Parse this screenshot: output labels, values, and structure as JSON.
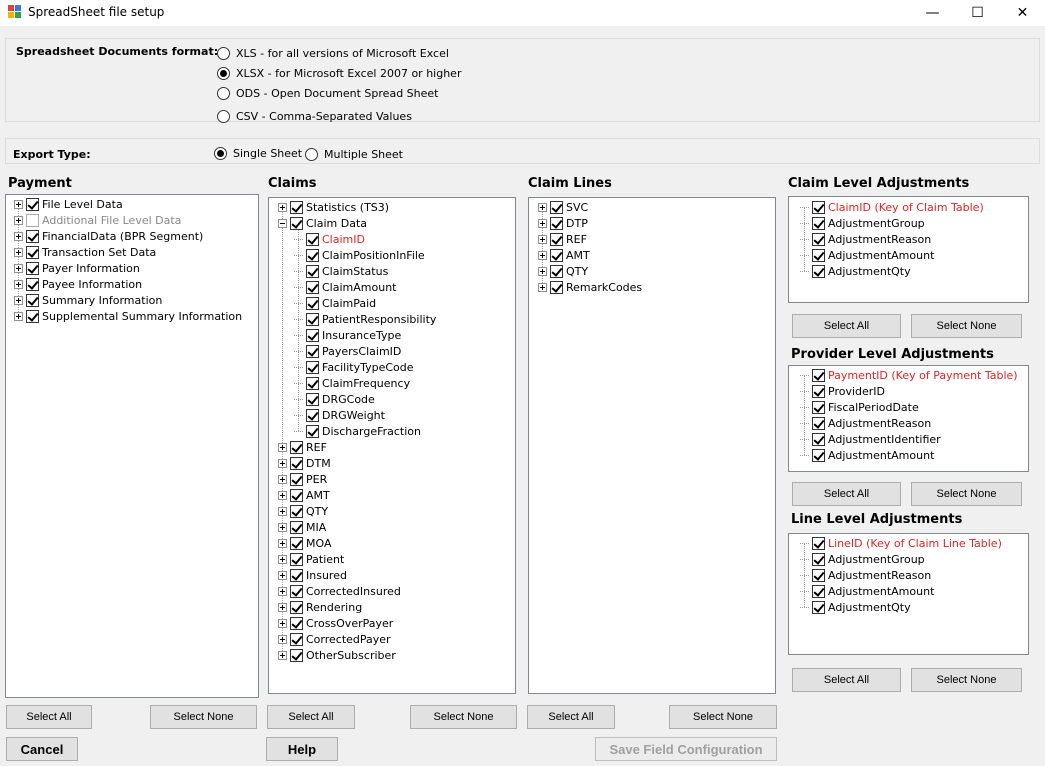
{
  "window": {
    "title": "SpreadSheet file setup",
    "minimize_glyph": "—",
    "maximize_glyph": "☐",
    "close_glyph": "✕"
  },
  "format": {
    "label": "Spreadsheet Documents format:",
    "options": [
      {
        "label": "XLS - for all versions of Microsoft Excel",
        "checked": false
      },
      {
        "label": "XLSX - for Microsoft Excel 2007 or higher",
        "checked": true
      },
      {
        "label": "ODS - Open Document Spread Sheet",
        "checked": false
      },
      {
        "label": "CSV - Comma-Separated Values",
        "checked": false
      }
    ]
  },
  "export_type": {
    "label": "Export Type:",
    "options": [
      {
        "label": "Single Sheet",
        "checked": true
      },
      {
        "label": "Multiple Sheet",
        "checked": false
      }
    ]
  },
  "payment": {
    "title": "Payment",
    "items": [
      {
        "label": "File Level Data",
        "expander": "plus",
        "checked": true,
        "style": ""
      },
      {
        "label": "Additional File Level Data",
        "expander": "plus",
        "checked": false,
        "style": "gray"
      },
      {
        "label": "FinancialData (BPR Segment)",
        "expander": "plus",
        "checked": true,
        "style": ""
      },
      {
        "label": "Transaction Set Data",
        "expander": "plus",
        "checked": true,
        "style": ""
      },
      {
        "label": "Payer Information",
        "expander": "plus",
        "checked": true,
        "style": ""
      },
      {
        "label": "Payee Information",
        "expander": "plus",
        "checked": true,
        "style": ""
      },
      {
        "label": "Summary Information",
        "expander": "plus",
        "checked": true,
        "style": ""
      },
      {
        "label": "Supplemental Summary Information",
        "expander": "plus",
        "checked": true,
        "style": ""
      }
    ],
    "select_all": "Select All",
    "select_none": "Select None"
  },
  "claims": {
    "title": "Claims",
    "items": [
      {
        "label": "Statistics (TS3)",
        "expander": "plus",
        "checked": true,
        "level": 0,
        "style": ""
      },
      {
        "label": "Claim Data",
        "expander": "minus",
        "checked": true,
        "level": 0,
        "style": ""
      },
      {
        "label": "ClaimID",
        "expander": "",
        "checked": true,
        "level": 1,
        "style": "red"
      },
      {
        "label": "ClaimPositionInFile",
        "expander": "",
        "checked": true,
        "level": 1,
        "style": ""
      },
      {
        "label": "ClaimStatus",
        "expander": "",
        "checked": true,
        "level": 1,
        "style": ""
      },
      {
        "label": "ClaimAmount",
        "expander": "",
        "checked": true,
        "level": 1,
        "style": ""
      },
      {
        "label": "ClaimPaid",
        "expander": "",
        "checked": true,
        "level": 1,
        "style": ""
      },
      {
        "label": "PatientResponsibility",
        "expander": "",
        "checked": true,
        "level": 1,
        "style": ""
      },
      {
        "label": "InsuranceType",
        "expander": "",
        "checked": true,
        "level": 1,
        "style": ""
      },
      {
        "label": "PayersClaimID",
        "expander": "",
        "checked": true,
        "level": 1,
        "style": ""
      },
      {
        "label": "FacilityTypeCode",
        "expander": "",
        "checked": true,
        "level": 1,
        "style": ""
      },
      {
        "label": "ClaimFrequency",
        "expander": "",
        "checked": true,
        "level": 1,
        "style": ""
      },
      {
        "label": "DRGCode",
        "expander": "",
        "checked": true,
        "level": 1,
        "style": ""
      },
      {
        "label": "DRGWeight",
        "expander": "",
        "checked": true,
        "level": 1,
        "style": ""
      },
      {
        "label": "DischargeFraction",
        "expander": "",
        "checked": true,
        "level": 1,
        "style": ""
      },
      {
        "label": "REF",
        "expander": "plus",
        "checked": true,
        "level": 0,
        "style": ""
      },
      {
        "label": "DTM",
        "expander": "plus",
        "checked": true,
        "level": 0,
        "style": ""
      },
      {
        "label": "PER",
        "expander": "plus",
        "checked": true,
        "level": 0,
        "style": ""
      },
      {
        "label": "AMT",
        "expander": "plus",
        "checked": true,
        "level": 0,
        "style": ""
      },
      {
        "label": "QTY",
        "expander": "plus",
        "checked": true,
        "level": 0,
        "style": ""
      },
      {
        "label": "MIA",
        "expander": "plus",
        "checked": true,
        "level": 0,
        "style": ""
      },
      {
        "label": "MOA",
        "expander": "plus",
        "checked": true,
        "level": 0,
        "style": ""
      },
      {
        "label": "Patient",
        "expander": "plus",
        "checked": true,
        "level": 0,
        "style": ""
      },
      {
        "label": "Insured",
        "expander": "plus",
        "checked": true,
        "level": 0,
        "style": ""
      },
      {
        "label": "CorrectedInsured",
        "expander": "plus",
        "checked": true,
        "level": 0,
        "style": ""
      },
      {
        "label": "Rendering",
        "expander": "plus",
        "checked": true,
        "level": 0,
        "style": ""
      },
      {
        "label": "CrossOverPayer",
        "expander": "plus",
        "checked": true,
        "level": 0,
        "style": ""
      },
      {
        "label": "CorrectedPayer",
        "expander": "plus",
        "checked": true,
        "level": 0,
        "style": ""
      },
      {
        "label": "OtherSubscriber",
        "expander": "plus",
        "checked": true,
        "level": 0,
        "style": ""
      }
    ],
    "select_all": "Select All",
    "select_none": "Select None"
  },
  "claim_lines": {
    "title": "Claim Lines",
    "items": [
      {
        "label": "SVC",
        "expander": "plus",
        "checked": true,
        "style": ""
      },
      {
        "label": "DTP",
        "expander": "plus",
        "checked": true,
        "style": ""
      },
      {
        "label": "REF",
        "expander": "plus",
        "checked": true,
        "style": ""
      },
      {
        "label": "AMT",
        "expander": "plus",
        "checked": true,
        "style": ""
      },
      {
        "label": "QTY",
        "expander": "plus",
        "checked": true,
        "style": ""
      },
      {
        "label": "RemarkCodes",
        "expander": "plus",
        "checked": true,
        "style": ""
      }
    ],
    "select_all": "Select All",
    "select_none": "Select None"
  },
  "claim_adj": {
    "title": "Claim Level Adjustments",
    "items": [
      {
        "label": "ClaimID (Key of Claim Table)",
        "checked": true,
        "style": "red"
      },
      {
        "label": "AdjustmentGroup",
        "checked": true,
        "style": ""
      },
      {
        "label": "AdjustmentReason",
        "checked": true,
        "style": ""
      },
      {
        "label": "AdjustmentAmount",
        "checked": true,
        "style": ""
      },
      {
        "label": "AdjustmentQty",
        "checked": true,
        "style": ""
      }
    ],
    "select_all": "Select All",
    "select_none": "Select None"
  },
  "provider_adj": {
    "title": "Provider Level Adjustments",
    "items": [
      {
        "label": "PaymentID (Key of Payment Table)",
        "checked": true,
        "style": "red"
      },
      {
        "label": "ProviderID",
        "checked": true,
        "style": ""
      },
      {
        "label": "FiscalPeriodDate",
        "checked": true,
        "style": ""
      },
      {
        "label": "AdjustmentReason",
        "checked": true,
        "style": ""
      },
      {
        "label": "AdjustmentIdentifier",
        "checked": true,
        "style": ""
      },
      {
        "label": "AdjustmentAmount",
        "checked": true,
        "style": ""
      }
    ],
    "select_all": "Select All",
    "select_none": "Select None"
  },
  "line_adj": {
    "title": "Line Level Adjustments",
    "items": [
      {
        "label": "LineID (Key of Claim Line Table)",
        "checked": true,
        "style": "red"
      },
      {
        "label": "AdjustmentGroup",
        "checked": true,
        "style": ""
      },
      {
        "label": "AdjustmentReason",
        "checked": true,
        "style": ""
      },
      {
        "label": "AdjustmentAmount",
        "checked": true,
        "style": ""
      },
      {
        "label": "AdjustmentQty",
        "checked": true,
        "style": ""
      }
    ],
    "select_all": "Select All",
    "select_none": "Select None"
  },
  "footer": {
    "cancel": "Cancel",
    "help": "Help",
    "save": "Save Field Configuration"
  }
}
